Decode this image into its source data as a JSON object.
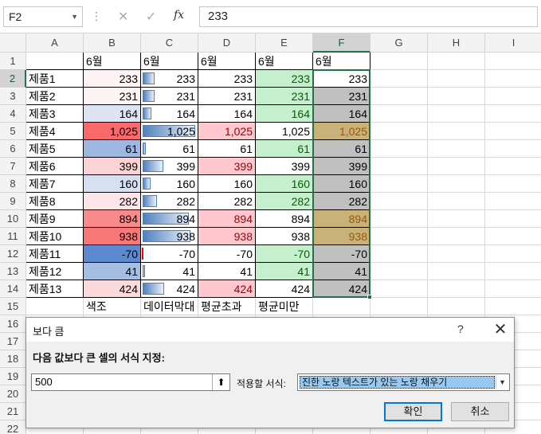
{
  "formula_bar": {
    "name_box": "F2",
    "value": "233",
    "fx_label": "fx",
    "cancel_icon": "✕",
    "enter_icon": "✓",
    "separator": "⋮"
  },
  "sheet": {
    "columns": [
      "A",
      "B",
      "C",
      "D",
      "E",
      "F",
      "G",
      "H",
      "I"
    ],
    "rows": [
      "1",
      "2",
      "3",
      "4",
      "5",
      "6",
      "7",
      "8",
      "9",
      "10",
      "11",
      "12",
      "13",
      "14",
      "15",
      "16",
      "17",
      "18",
      "19",
      "20",
      "21",
      "22"
    ],
    "selected_column": "F",
    "selected_row": "2",
    "header_row": [
      "",
      "6월",
      "6월",
      "6월",
      "6월",
      "6월"
    ],
    "products": [
      "제품1",
      "제품2",
      "제품3",
      "제품4",
      "제품5",
      "제품6",
      "제품7",
      "제품8",
      "제품9",
      "제품10",
      "제품11",
      "제품12",
      "제품13"
    ],
    "values": [
      "233",
      "231",
      "164",
      "1,025",
      "61",
      "399",
      "160",
      "282",
      "894",
      "938",
      "-70",
      "41",
      "424"
    ],
    "numeric_values": [
      233,
      231,
      164,
      1025,
      61,
      399,
      160,
      282,
      894,
      938,
      -70,
      41,
      424
    ],
    "footer_labels": [
      "색조",
      "데이터막대",
      "평균초과",
      "평균미만"
    ],
    "color_scale_fills": [
      "#fdf3f4",
      "#fdf4f5",
      "#dde5f3",
      "#f8696b",
      "#9db7e0",
      "#fcd3d5",
      "#d7e0f1",
      "#fde6e7",
      "#f98a8c",
      "#f8787a",
      "#5b8ad0",
      "#a7bee3",
      "#fcd9da"
    ],
    "above_avg_fill": "#ffc7ce",
    "above_avg_text": "#9c0006",
    "below_avg_fill": "#c6efce",
    "below_avg_text": "#006100",
    "gray_fill": "#c0c0c0",
    "gold_fill": "#c8b27a",
    "gold_text": "#9c5700"
  },
  "dialog": {
    "title": "보다 큼",
    "help": "?",
    "close": "✕",
    "prompt": "다음 값보다 큰 셀의 서식 지정:",
    "input_value": "500",
    "ref_button_icon": "⬆",
    "format_label": "적용할 서식:",
    "format_value": "진한 노랑 텍스트가 있는 노랑 채우기",
    "dropdown_icon": "▼",
    "ok_label": "확인",
    "cancel_label": "취소"
  }
}
